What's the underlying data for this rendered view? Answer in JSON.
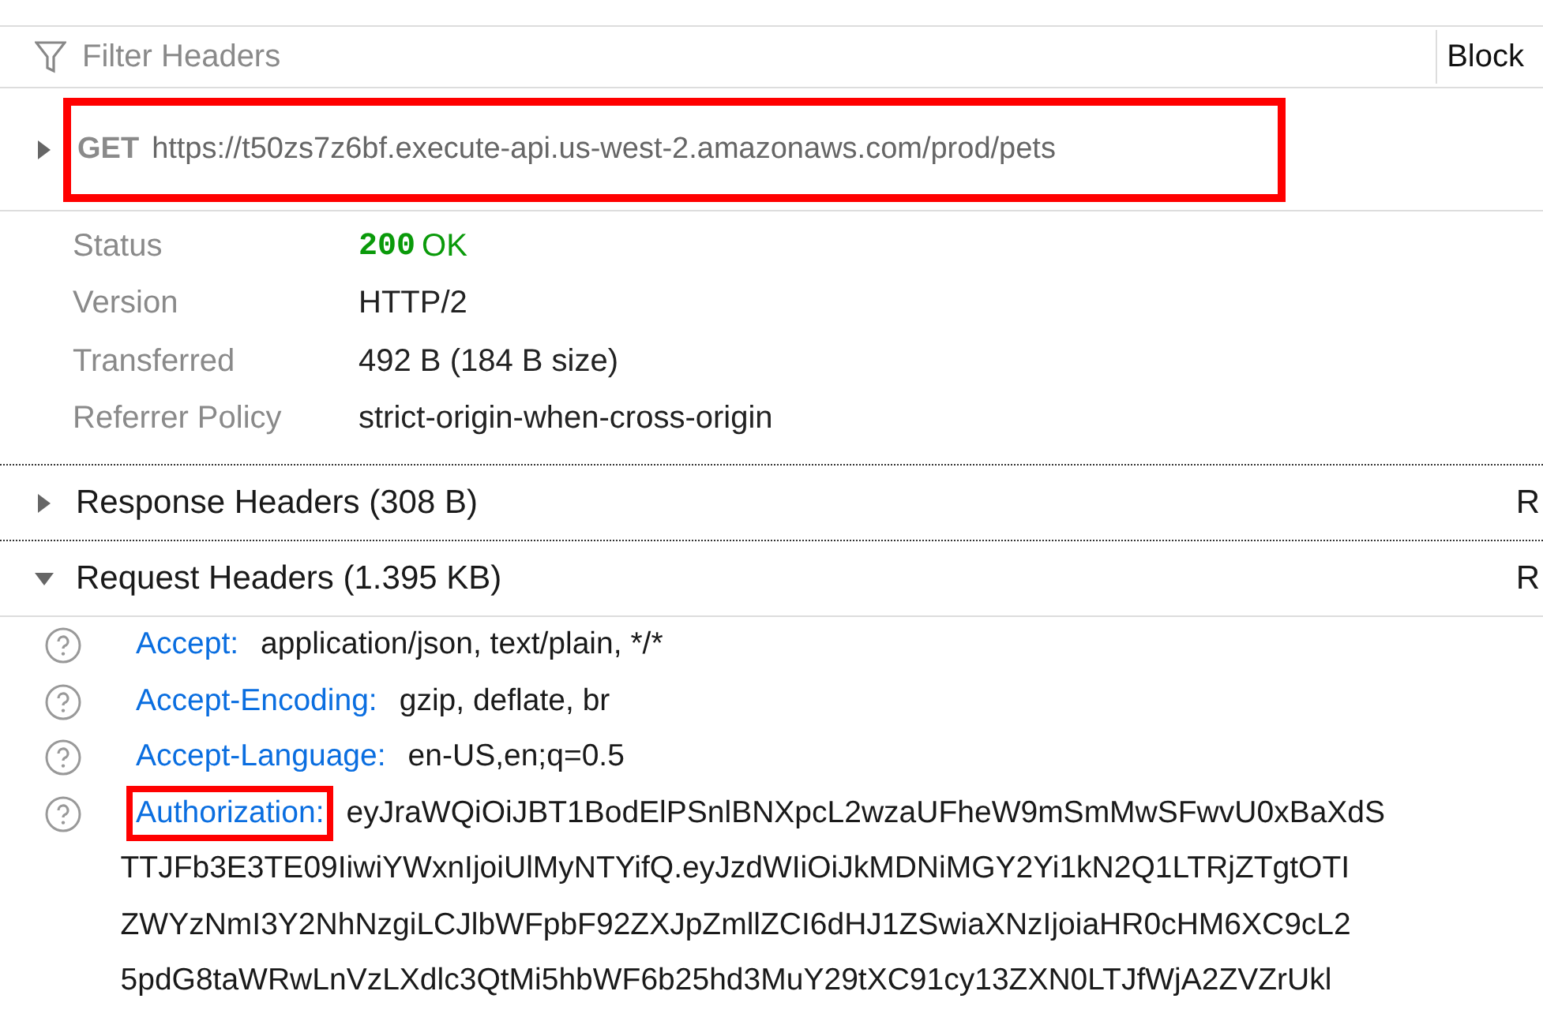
{
  "filter": {
    "placeholder": "Filter Headers"
  },
  "block_button": {
    "label": "Block"
  },
  "request_line": {
    "method": "GET",
    "url": "https://t50zs7z6bf.execute-api.us-west-2.amazonaws.com/prod/pets",
    "expanded": false,
    "highlighted": true
  },
  "summary": [
    {
      "label": "Status",
      "value": "200",
      "value_2": "OK",
      "kind": "status"
    },
    {
      "label": "Version",
      "value": "HTTP/2",
      "kind": "text"
    },
    {
      "label": "Transferred",
      "value": "492 B (184 B size)",
      "kind": "text"
    },
    {
      "label": "Referrer Policy",
      "value": "strict-origin-when-cross-origin",
      "kind": "text"
    }
  ],
  "sections": [
    {
      "title": "Response Headers (308 B)",
      "expanded": false,
      "column_2": "R"
    },
    {
      "title": "Request Headers (1.395 KB)",
      "expanded": true,
      "column_2": "R",
      "headers": [
        {
          "name": "Accept:",
          "highlighted": false,
          "value_lines": [
            "application/json, text/plain, */*"
          ]
        },
        {
          "name": "Accept-Encoding:",
          "highlighted": false,
          "value_lines": [
            "gzip, deflate, br"
          ]
        },
        {
          "name": "Accept-Language:",
          "highlighted": false,
          "value_lines": [
            "en-US,en;q=0.5"
          ]
        },
        {
          "name": "Authorization:",
          "highlighted": true,
          "value_lines": [
            "eyJraWQiOiJBT1BodElPSnlBNXpcL2wzaUFheW9mSmMwSFwvU0xBaXdS",
            "TTJFb3E3TE09IiwiYWxnIjoiUlMyNTYifQ.eyJzdWIiOiJkMDNiMGY2Yi1kN2Q1LTRjZTgtOTI",
            "ZWYzNmI3Y2NhNzgiLCJlbWFpbF92ZXJpZmllZCI6dHJ1ZSwiaXNzIjoiaHR0cHM6XC9cL2",
            "5pdG8taWRwLnVzLXdlc3QtMi5hbWF6b25hd3MuY29tXC91cy13ZXN0LTJfWjA2ZVZrUkl"
          ]
        }
      ]
    }
  ]
}
